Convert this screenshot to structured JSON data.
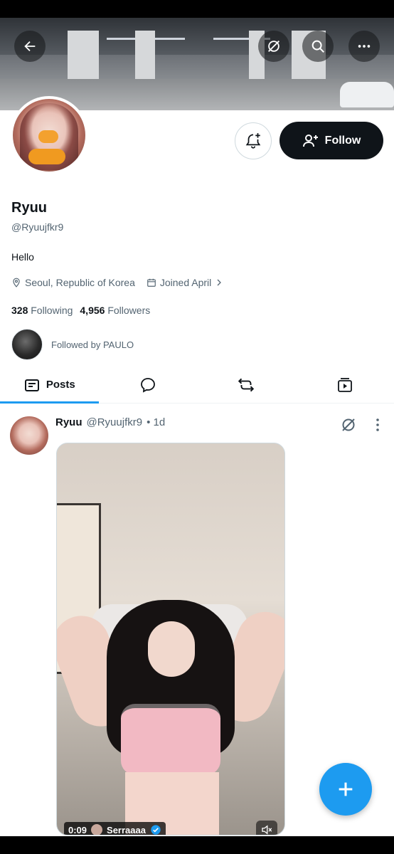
{
  "header": {
    "back_icon": "arrow-left-icon",
    "grok_icon": "grok-icon",
    "search_icon": "search-icon",
    "more_icon": "more-horizontal-icon"
  },
  "profile": {
    "name": "Ryuu",
    "handle": "@Ryuujfkr9",
    "bio": "Hello",
    "location": "Seoul, Republic of Korea",
    "joined": "Joined April",
    "following_count": "328",
    "following_label": "Following",
    "followers_count": "4,956",
    "followers_label": "Followers",
    "followed_by": "Followed by PAULO"
  },
  "actions": {
    "follow_label": "Follow",
    "notify_icon": "bell-plus-icon"
  },
  "tabs": [
    {
      "label": "Posts",
      "icon": "posts-icon",
      "active": true
    },
    {
      "label": "",
      "icon": "reply-icon"
    },
    {
      "label": "",
      "icon": "repost-icon"
    },
    {
      "label": "",
      "icon": "media-icon"
    }
  ],
  "post": {
    "name": "Ryuu",
    "handle": "@Ryuujfkr9",
    "time": "• 1d",
    "video_time": "0:09",
    "video_credit": "Serraaaa"
  },
  "colors": {
    "accent": "#1d9bf0",
    "text": "#0f1419",
    "secondary": "#536471"
  }
}
